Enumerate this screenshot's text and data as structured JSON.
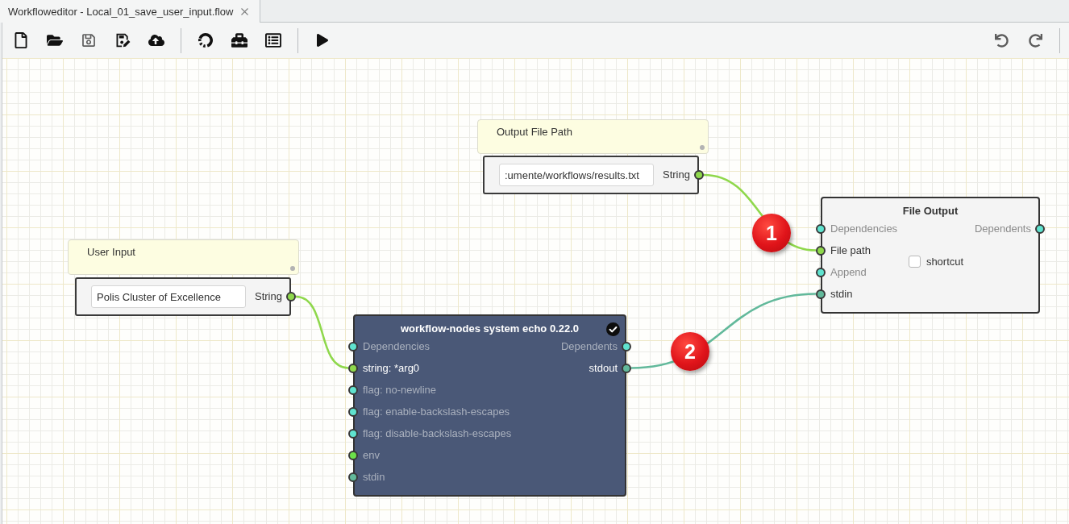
{
  "tabs": [
    {
      "label": "Workfloweditor - Local_01_save_user_input.flow",
      "selected": true
    }
  ],
  "toolbar": {
    "main_buttons": [
      {
        "disabled": false
      },
      {
        "disabled": false
      },
      {
        "disabled": true
      },
      {
        "disabled": false
      },
      {
        "disabled": false
      },
      {
        "disabled": false
      },
      {
        "disabled": false
      },
      {
        "disabled": false
      },
      {
        "disabled": false
      }
    ],
    "history_buttons": [
      {
        "disabled": true
      },
      {
        "disabled": true
      }
    ]
  },
  "canvas": {
    "nodes": [
      {
        "kind": "note",
        "text": "Output File Path"
      },
      {
        "kind": "input",
        "value": ":umente/workflows/results.txt",
        "port": {
          "label": "String",
          "color": "#8fd84c",
          "connected": true
        }
      },
      {
        "kind": "note",
        "text": "User Input"
      },
      {
        "kind": "input",
        "value": "Polis Cluster of Excellence",
        "port": {
          "label": "String",
          "color": "#8fd84c",
          "connected": true
        }
      },
      {
        "kind": "builtin",
        "title": "File Output",
        "inputs": [
          {
            "label": "Dependencies",
            "color": "#5fe3cf",
            "connected": false
          },
          {
            "label": "File path",
            "color": "#8fd84c",
            "connected": true
          },
          {
            "label": "Append",
            "color": "#5fe3cf",
            "connected": false
          },
          {
            "label": "stdin",
            "color": "#62b99b",
            "connected": true
          }
        ],
        "outputs": [
          {
            "label": "Dependents",
            "color": "#5fe3cf",
            "connected": false
          }
        ],
        "options": [
          {
            "label": "shortcut",
            "checked": false
          }
        ]
      },
      {
        "kind": "tool",
        "title": "workflow-nodes system echo 0.22.0",
        "inputs": [
          {
            "label": "Dependencies",
            "color": "#5fe3cf",
            "connected": false
          },
          {
            "label": "string: *arg0",
            "color": "#8fd84c",
            "connected": true
          },
          {
            "label": "flag: no-newline",
            "color": "#5fe3cf",
            "connected": false
          },
          {
            "label": "flag: enable-backslash-escapes",
            "color": "#5fe3cf",
            "connected": false
          },
          {
            "label": "flag: disable-backslash-escapes",
            "color": "#5fe3cf",
            "connected": false
          },
          {
            "label": "env",
            "color": "#6be04a",
            "connected": false
          },
          {
            "label": "stdin",
            "color": "#62b99b",
            "connected": false
          }
        ],
        "outputs": [
          {
            "label": "Dependents",
            "color": "#5fe3cf",
            "connected": false
          },
          {
            "label": "stdout",
            "color": "#62b99b",
            "connected": true
          }
        ]
      }
    ],
    "markers": [
      {
        "label": "1"
      },
      {
        "label": "2"
      }
    ]
  }
}
